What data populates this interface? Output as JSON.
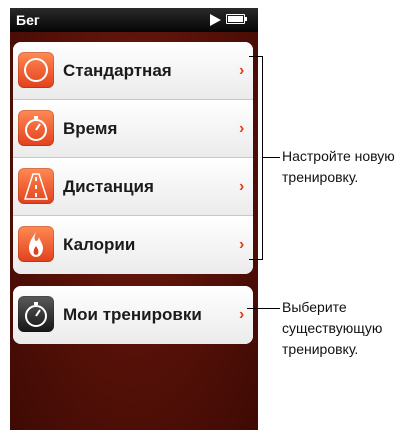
{
  "status_bar": {
    "title": "Бег",
    "play_icon": "play-icon",
    "battery_icon": "battery-icon"
  },
  "menu": {
    "workout_items": [
      {
        "label": "Стандартная",
        "icon": "circle-icon"
      },
      {
        "label": "Время",
        "icon": "stopwatch-icon"
      },
      {
        "label": "Дистанция",
        "icon": "road-icon"
      },
      {
        "label": "Калории",
        "icon": "flame-icon"
      }
    ],
    "my_workouts": {
      "label": "Мои тренировки",
      "icon": "stopwatch-icon"
    },
    "chevron": "›"
  },
  "callouts": {
    "new_workout": [
      "Настройте новую",
      "тренировку."
    ],
    "existing_workout": [
      "Выберите",
      "существующую",
      "тренировку."
    ]
  },
  "colors": {
    "accent": "#e1401c",
    "background": "#561108"
  }
}
